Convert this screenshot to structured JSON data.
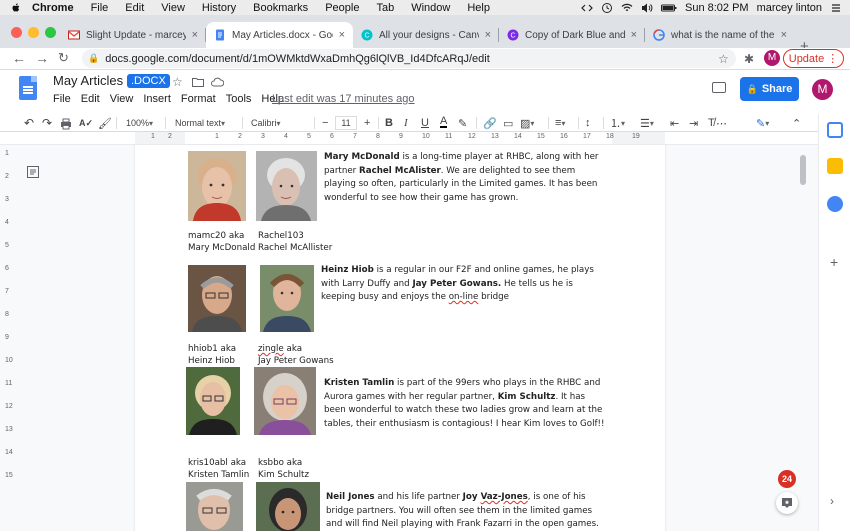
{
  "mac_menu": {
    "app": "Chrome",
    "items": [
      "File",
      "Edit",
      "View",
      "History",
      "Bookmarks",
      "People",
      "Tab",
      "Window",
      "Help"
    ],
    "clock": "Sun 8:02 PM",
    "user": "marcey linton"
  },
  "tabs": [
    {
      "title": "Slight Update - marceylinto",
      "icon": "gmail-icon",
      "active": false
    },
    {
      "title": "May Articles.docx - Google",
      "icon": "docs-icon",
      "active": true
    },
    {
      "title": "All your designs - Canva",
      "icon": "canva-icon",
      "active": false
    },
    {
      "title": "Copy of Dark Blue and Oran",
      "icon": "canva-icon",
      "active": false
    },
    {
      "title": "what is the name of the cha",
      "icon": "google-icon",
      "active": false
    }
  ],
  "address": {
    "url": "docs.google.com/document/d/1mOWMktdWxaDmhQg6lQlVB_Id4DfcARqJ/edit",
    "profile_initial": "M",
    "update_label": "Update"
  },
  "doc": {
    "title": "May Articles",
    "badge": ".DOCX",
    "menus": [
      "File",
      "Edit",
      "View",
      "Insert",
      "Format",
      "Tools",
      "Help"
    ],
    "last_edit": "Last edit was 17 minutes ago",
    "share_label": "Share",
    "profile_initial": "M"
  },
  "toolbar": {
    "zoom": "100%",
    "style": "Normal text",
    "font": "Calibri",
    "font_size": "11"
  },
  "ruler": {
    "numbers": [
      "1",
      "2",
      "1",
      "2",
      "3",
      "4",
      "5",
      "6",
      "7",
      "8",
      "9",
      "10",
      "11",
      "12",
      "13",
      "14",
      "15",
      "16",
      "17",
      "18",
      "19"
    ]
  },
  "vruler": {
    "numbers": [
      "1",
      "2",
      "3",
      "4",
      "5",
      "6",
      "7",
      "8",
      "9",
      "10",
      "11",
      "12",
      "13",
      "14",
      "15"
    ]
  },
  "content": {
    "p1_bold_a": "Mary McDonald",
    "p1_text_a": " is a long-time player at RHBC, along with her partner ",
    "p1_bold_b": "Rachel McAlister",
    "p1_text_b": ". We are delighted to see them playing so often, particularly in the Limited games. It has been wonderful to see how their game has grown.",
    "cap1a_1": "mamc20 aka",
    "cap1a_2": "Mary McDonald",
    "cap1b_1": "Rachel103",
    "cap1b_2": "Rachel McAllister",
    "p2_bold_a": "Heinz Hiob",
    "p2_text_a": " is a regular in our F2F and online games, he plays with Larry Duffy and ",
    "p2_bold_b": "Jay Peter Gowans.",
    "p2_text_b": " He tells us he is keeping busy and enjoys the ",
    "p2_squig": "on-line",
    "p2_text_c": " bridge",
    "cap2a_1": "hhiob1 aka",
    "cap2a_2": "Heinz Hiob",
    "cap2b_1a": "zingle",
    "cap2b_1b": " aka",
    "cap2b_2": "Jay Peter Gowans",
    "p3_bold_a": "Kristen Tamlin",
    "p3_text_a": " is part of the 99ers who plays in the RHBC and Aurora games with her regular partner, ",
    "p3_bold_b": "Kim Schultz",
    "p3_text_b": ". It has been wonderful to watch these two ladies grow and learn at the tables, their enthusiasm is contagious!  I hear Kim loves to Golf!!",
    "cap3a_1": "kris10abl aka",
    "cap3a_2": "Kristen Tamlin",
    "cap3b_1": "ksbbo aka",
    "cap3b_2": "Kim Schultz",
    "p4_bold_a": "Neil Jones",
    "p4_text_a": " and his life partner ",
    "p4_bold_b1": "Joy ",
    "p4_bold_b2": "Vaz-Jones",
    "p4_text_b": ", is one of his bridge partners.  You will often see them in the limited games and will find Neil playing with Frank Fazarri in the open games."
  },
  "badge_count": "24",
  "colors": {
    "accent": "#1a73e8",
    "update": "#d93025",
    "profile": "#b0176d"
  }
}
